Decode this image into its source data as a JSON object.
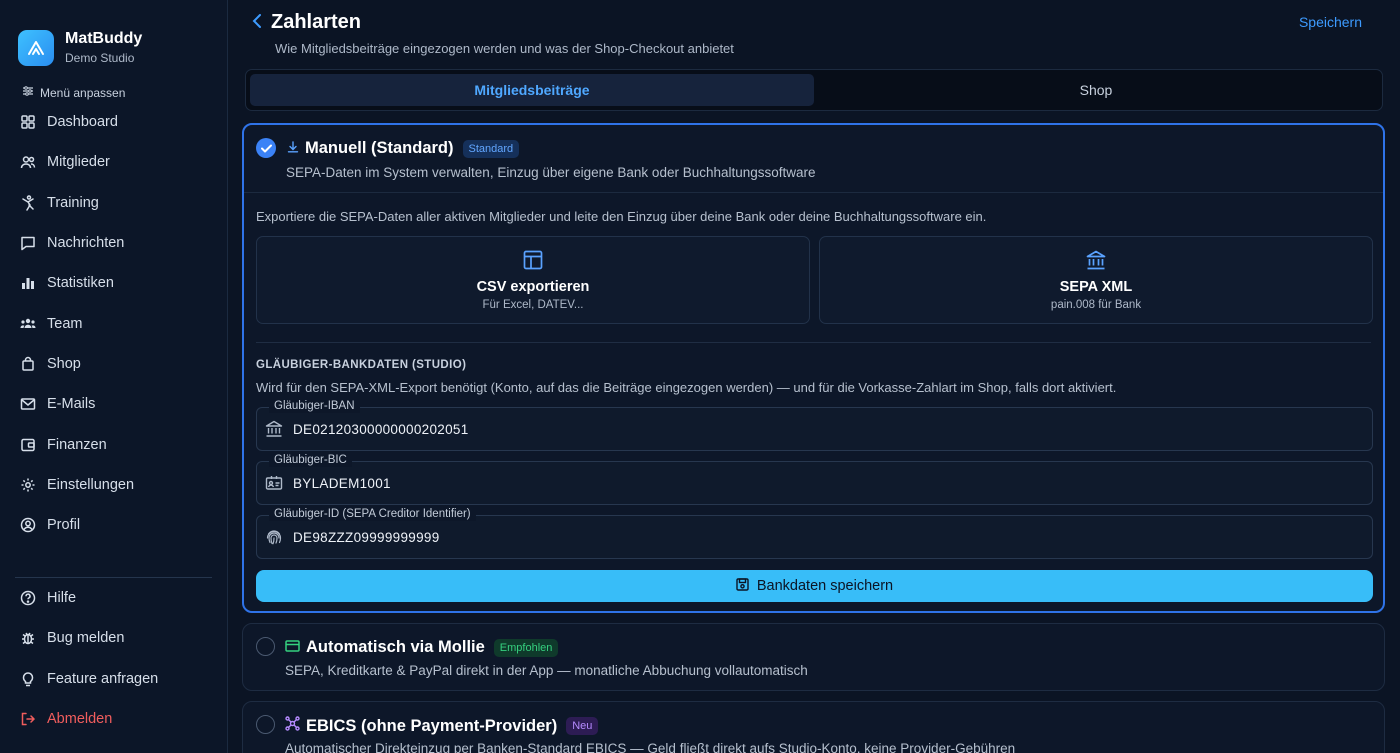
{
  "brand": {
    "name": "MatBuddy",
    "subtitle": "Demo Studio"
  },
  "sidebar": {
    "menu_adjust": "Menü anpassen",
    "items": [
      {
        "label": "Dashboard",
        "icon": "grid-icon"
      },
      {
        "label": "Mitglieder",
        "icon": "users-icon"
      },
      {
        "label": "Training",
        "icon": "martial-arts-icon"
      },
      {
        "label": "Nachrichten",
        "icon": "chat-icon"
      },
      {
        "label": "Statistiken",
        "icon": "bar-chart-icon"
      },
      {
        "label": "Team",
        "icon": "team-icon"
      },
      {
        "label": "Shop",
        "icon": "shopping-bag-icon"
      },
      {
        "label": "E-Mails",
        "icon": "mail-icon"
      },
      {
        "label": "Finanzen",
        "icon": "wallet-icon"
      },
      {
        "label": "Einstellungen",
        "icon": "gear-icon"
      },
      {
        "label": "Profil",
        "icon": "user-circle-icon"
      }
    ],
    "bottom_items": [
      {
        "label": "Hilfe",
        "icon": "help-icon"
      },
      {
        "label": "Bug melden",
        "icon": "bug-icon"
      },
      {
        "label": "Feature anfragen",
        "icon": "lightbulb-icon"
      },
      {
        "label": "Abmelden",
        "icon": "logout-icon"
      }
    ]
  },
  "header": {
    "title": "Zahlarten",
    "subtitle": "Wie Mitgliedsbeiträge eingezogen werden und was der Shop-Checkout anbietet",
    "save_label": "Speichern"
  },
  "tabs": [
    {
      "label": "Mitgliedsbeiträge",
      "active": true
    },
    {
      "label": "Shop",
      "active": false
    }
  ],
  "options": {
    "manual": {
      "title": "Manuell (Standard)",
      "badge": "Standard",
      "description": "SEPA-Daten im System verwalten, Einzug über eigene Bank oder Buchhaltungssoftware",
      "selected": true,
      "intro": "Exportiere die SEPA-Daten aller aktiven Mitglieder und leite den Einzug über deine Bank oder deine Buchhaltungssoftware ein.",
      "exports": [
        {
          "title": "CSV exportieren",
          "subtitle": "Für Excel, DATEV..."
        },
        {
          "title": "SEPA XML",
          "subtitle": "pain.008 für Bank"
        }
      ],
      "bank": {
        "section_title": "GLÄUBIGER-BANKDATEN (STUDIO)",
        "section_desc": "Wird für den SEPA-XML-Export benötigt (Konto, auf das die Beiträge eingezogen werden) — und für die Vorkasse-Zahlart im Shop, falls dort aktiviert.",
        "iban_label": "Gläubiger-IBAN",
        "iban_value": "DE02120300000000202051",
        "bic_label": "Gläubiger-BIC",
        "bic_value": "BYLADEM1001",
        "creditor_label": "Gläubiger-ID (SEPA Creditor Identifier)",
        "creditor_value": "DE98ZZZ09999999999",
        "save_label": "Bankdaten speichern"
      }
    },
    "mollie": {
      "title": "Automatisch via Mollie",
      "badge": "Empfohlen",
      "description": "SEPA, Kreditkarte & PayPal direkt in der App — monatliche Abbuchung vollautomatisch",
      "selected": false
    },
    "ebics": {
      "title": "EBICS (ohne Payment-Provider)",
      "badge": "Neu",
      "description": "Automatischer Direkteinzug per Banken-Standard EBICS — Geld fließt direkt aufs Studio-Konto, keine Provider-Gebühren",
      "selected": false
    }
  },
  "colors": {
    "accent": "#3b82f6",
    "button": "#38bdf8",
    "danger": "#f05d5d",
    "background": "#0b1424"
  }
}
